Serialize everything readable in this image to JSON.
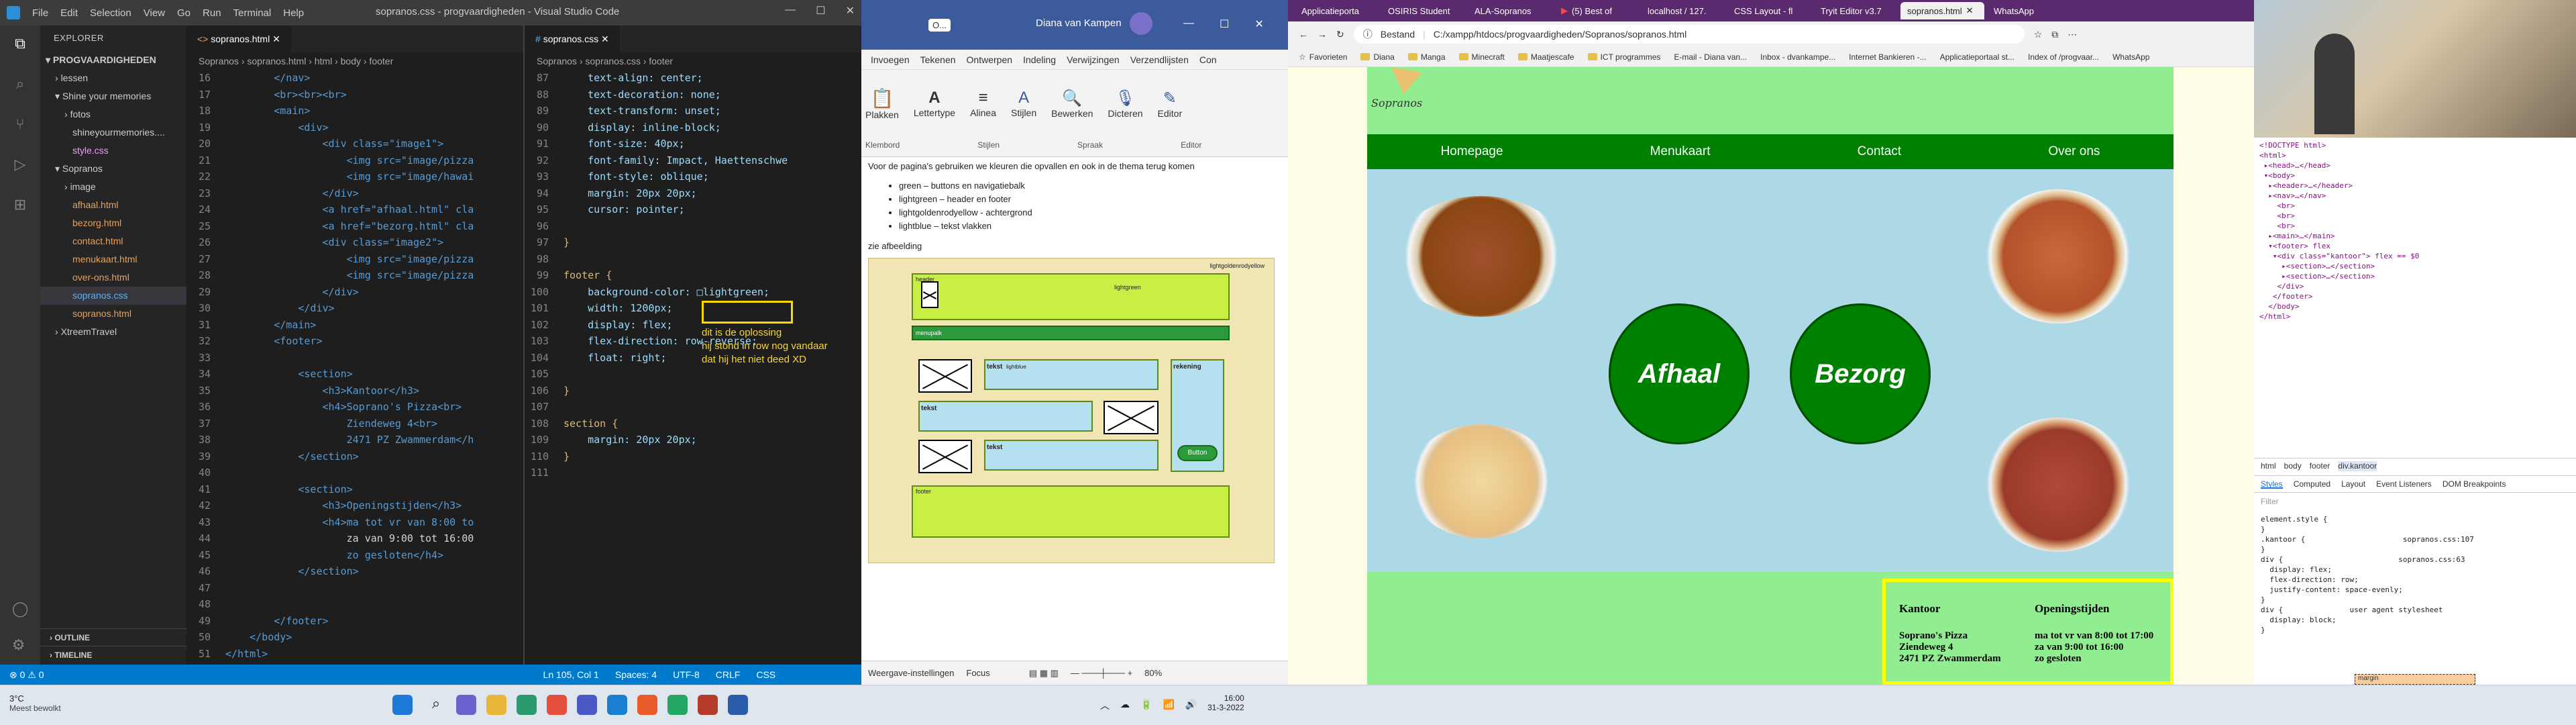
{
  "vscode": {
    "menu": [
      "File",
      "Edit",
      "Selection",
      "View",
      "Go",
      "Run",
      "Terminal",
      "Help"
    ],
    "window_title": "sopranos.css - progvaardigheden - Visual Studio Code",
    "explorer_title": "EXPLORER",
    "workspace": "PROGVAARDIGHEDEN",
    "tree": [
      "lessen",
      "Shine your memories",
      "fotos",
      "shineyourmemories....",
      "style.css",
      "Sopranos",
      "image",
      "afhaal.html",
      "bezorg.html",
      "contact.html",
      "menukaart.html",
      "over-ons.html",
      "sopranos.css",
      "sopranos.html",
      "XtreemTravel"
    ],
    "outline": "OUTLINE",
    "timeline": "TIMELINE",
    "left_tab": "sopranos.html",
    "left_breadcrumb": "Sopranos › sopranos.html › html › body › footer",
    "left_lines": [
      "16",
      "17",
      "18",
      "19",
      "20",
      "21",
      "22",
      "23",
      "24",
      "25",
      "26",
      "27",
      "28",
      "29",
      "30",
      "31",
      "32",
      "33",
      "34",
      "35",
      "36",
      "37",
      "38",
      "39",
      "40",
      "41",
      "42",
      "43",
      "44",
      "45",
      "46",
      "47",
      "48",
      "49",
      "50",
      "51"
    ],
    "left_code": [
      "        </nav>",
      "        <br><br><br>",
      "        <main>",
      "            <div>",
      "                <div class=\"image1\">",
      "                    <img src=\"image/pizza",
      "                    <img src=\"image/hawai",
      "                </div>",
      "                <a href=\"afhaal.html\" cla",
      "                <a href=\"bezorg.html\" cla",
      "                <div class=\"image2\">",
      "                    <img src=\"image/pizza",
      "                    <img src=\"image/pizza",
      "                </div>",
      "            </div>",
      "        </main>",
      "        <footer>",
      "",
      "            <section>",
      "                <h3>Kantoor</h3>",
      "                <h4>Soprano's Pizza<br>",
      "                    Ziendeweg 4<br>",
      "                    2471 PZ Zwammerdam</h",
      "            </section>",
      "",
      "            <section>",
      "                <h3>Openingstijden</h3>",
      "                <h4>ma tot vr van 8:00 to",
      "                    za van 9:00 tot 16:00",
      "                    zo gesloten</h4>",
      "            </section>",
      "",
      "",
      "        </footer>",
      "    </body>",
      "</html>"
    ],
    "right_tab": "sopranos.css",
    "right_breadcrumb": "Sopranos › sopranos.css › footer",
    "right_lines": [
      "87",
      "88",
      "89",
      "90",
      "91",
      "92",
      "93",
      "94",
      "95",
      "96",
      "97",
      "98",
      "99",
      "100",
      "101",
      "102",
      "103",
      "104",
      "105",
      "106",
      "107",
      "108",
      "109",
      "110",
      "111"
    ],
    "right_code": [
      "    text-align: center;",
      "    text-decoration: none;",
      "    text-transform: unset;",
      "    display: inline-block;",
      "    font-size: 40px;",
      "    font-family: Impact, Haettenschwe",
      "    font-style: oblique;",
      "    margin: 20px 20px;",
      "    cursor: pointer;",
      "",
      "}",
      "",
      "footer {",
      "    background-color: □lightgreen;",
      "    width: 1200px;",
      "    display: flex;",
      "    flex-direction: row-reverse;",
      "    float: right;",
      "",
      "}",
      "",
      "section {",
      "    margin: 20px 20px;",
      "}",
      ""
    ],
    "annotation": "dit is de oplossing\nhij stond in row nog vandaar\ndat hij het niet deed XD",
    "status": [
      "⊗ 0  ⚠ 0",
      "Ln 105, Col 1",
      "Spaces: 4",
      "UTF-8",
      "CRLF",
      "CSS"
    ]
  },
  "word": {
    "title": "Diana van Kampen",
    "tabs": [
      "Invoegen",
      "Tekenen",
      "Ontwerpen",
      "Indeling",
      "Verwijzingen",
      "Verzendlijsten",
      "Con"
    ],
    "ribbon": [
      "Plakken",
      "Lettertype",
      "Alinea",
      "Stijlen",
      "Bewerken",
      "Dicteren",
      "Editor"
    ],
    "ribbon_groups": [
      "Klembord",
      "Stijlen",
      "Spraak",
      "Editor"
    ],
    "intro": "Voor de pagina's gebruiken we kleuren die opvallen en ook in de thema terug komen",
    "bullets": [
      "green – buttons en navigatiebalk",
      "lightgreen – header en footer",
      "lightgoldenrodyellow - achtergrond",
      "lightblue – tekst vlakken"
    ],
    "zie": "zie afbeelding",
    "mock_labels": [
      "lightgoldenrodyellow",
      "header",
      "lightgreen",
      "menupalk",
      "tekst",
      "lightblue",
      "tekst",
      "tekst",
      "rekening",
      "Button",
      "footer"
    ],
    "status": [
      "Weergave-instellingen",
      "Focus",
      "80%"
    ]
  },
  "browser": {
    "tabs": [
      "Applicatieporta",
      "OSIRIS Student",
      "ALA-Sopranos",
      "(5) Best of",
      "localhost / 127.",
      "CSS Layout - fl",
      "Tryit Editor v3.7",
      "sopranos.html",
      "WhatsApp"
    ],
    "url_label": "Bestand",
    "url": "C:/xampp/htdocs/progvaardigheden/Sopranos/sopranos.html",
    "bookmarks": [
      "Favorieten",
      "Diana",
      "Manga",
      "Minecraft",
      "Maatjescafe",
      "ICT programmes",
      "E-mail - Diana van...",
      "Inbox - dvankampe...",
      "Internet Bankieren -...",
      "Applicatieportaal st...",
      "Index of /progvaar...",
      "WhatsApp"
    ],
    "logo": "Sopranos",
    "nav": [
      "Homepage",
      "Menukaart",
      "Contact",
      "Over ons"
    ],
    "buttons": [
      "Afhaal",
      "Bezorg"
    ],
    "footer": {
      "kantoor_title": "Kantoor",
      "kantoor_lines": [
        "Soprano's Pizza",
        "Ziendeweg 4",
        "2471 PZ Zwammerdam"
      ],
      "open_title": "Openingstijden",
      "open_lines": [
        "ma tot vr van 8:00 tot 17:00",
        "za van 9:00 tot 16:00",
        "zo gesloten"
      ]
    }
  },
  "devtools": {
    "dom": "<!DOCTYPE html>\n<html>\n ▸<head>…</head>\n ▾<body>\n  ▸<header>…</header>\n  ▸<nav>…</nav>\n    <br>\n    <br>\n    <br>\n  ▸<main>…</main>\n  ▾<footer> flex\n   ▾<div class=\"kantoor\"> flex == $0\n     ▸<section>…</section>\n     ▸<section>…</section>\n    </div>\n   </footer>\n  </body>\n</html>",
    "crumbs": [
      "html",
      "body",
      "footer",
      "div.kantoor"
    ],
    "tabs": [
      "Styles",
      "Computed",
      "Layout",
      "Event Listeners",
      "DOM Breakpoints"
    ],
    "filter": "Filter",
    "styles": "element.style {\n}\n.kantoor {                      sopranos.css:107\n}\ndiv {                          sopranos.css:63\n  display: flex;\n  flex-direction: row;\n  justify-content: space-evenly;\n}\ndiv {               user agent stylesheet\n  display: block;\n}",
    "box": "margin"
  },
  "taskbar": {
    "weather_temp": "3°C",
    "weather_desc": "Meest bewolkt",
    "time": "16:00",
    "date": "31-3-2022"
  }
}
